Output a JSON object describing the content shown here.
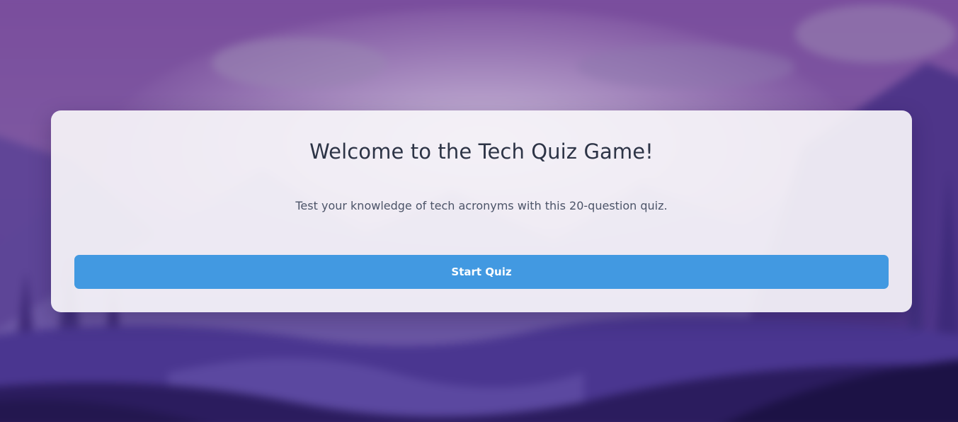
{
  "theme": {
    "accent": "#4299e1",
    "background_top": "#7a4f9e",
    "background_bottom": "#1c1245",
    "card_background": "#f4f2f7",
    "text_primary": "#2d3446",
    "text_secondary": "#4c5468"
  },
  "welcome": {
    "title": "Welcome to the Tech Quiz Game!",
    "description": "Test your knowledge of tech acronyms with this 20-question quiz.",
    "start_label": "Start Quiz"
  }
}
